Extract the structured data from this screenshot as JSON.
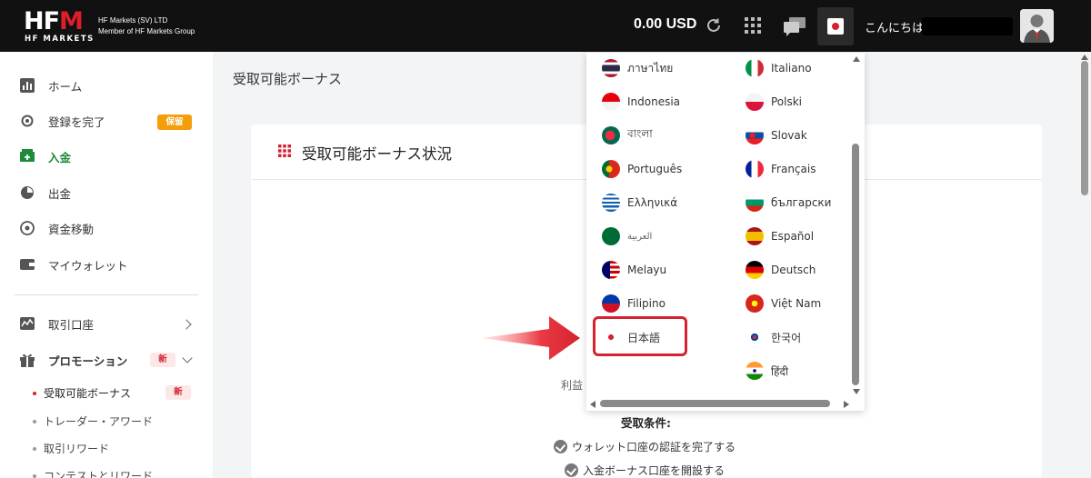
{
  "header": {
    "logo_main": "HFM",
    "logo_sub": "HF MARKETS",
    "company_line1": "HF Markets (SV) LTD",
    "company_line2": "Member of HF Markets Group",
    "balance": "0.00 USD",
    "greeting": "こんにちは"
  },
  "sidebar": {
    "items": [
      {
        "label": "ホーム",
        "icon": "chart-icon"
      },
      {
        "label": "登録を完了",
        "icon": "gear-icon",
        "badge": "保留"
      },
      {
        "label": "入金",
        "icon": "deposit-icon"
      },
      {
        "label": "出金",
        "icon": "withdraw-icon"
      },
      {
        "label": "資金移動",
        "icon": "transfer-icon"
      },
      {
        "label": "マイウォレット",
        "icon": "wallet-icon"
      },
      {
        "label": "取引口座",
        "icon": "trading-icon"
      },
      {
        "label": "プロモーション",
        "icon": "gift-icon",
        "badge": "新"
      }
    ],
    "sub_items": [
      {
        "label": "受取可能ボーナス",
        "badge": "新"
      },
      {
        "label": "トレーダー・アワード"
      },
      {
        "label": "取引リワード"
      },
      {
        "label": "コンテストとリワード"
      }
    ]
  },
  "main": {
    "page_title": "受取可能ボーナス",
    "card_title": "受取可能ボーナス状況",
    "profit_label": "利益",
    "conditions_title": "受取条件:",
    "conditions": [
      "ウォレット口座の認証を完了する",
      "入金ボーナス口座を開設する"
    ]
  },
  "languages": {
    "left": [
      "ภาษาไทย",
      "Indonesia",
      "বাংলা",
      "Português",
      "Ελληνικά",
      "العربية",
      "Melayu",
      "Filipino",
      "日本語"
    ],
    "right": [
      "Italiano",
      "Polski",
      "Slovak",
      "Français",
      "български",
      "Español",
      "Deutsch",
      "Việt Nam",
      "한국어",
      "हिंदी"
    ]
  },
  "colors": {
    "brand_red": "#d3232f",
    "active_green": "#1e8a3c",
    "pending_orange": "#f59e0b"
  }
}
